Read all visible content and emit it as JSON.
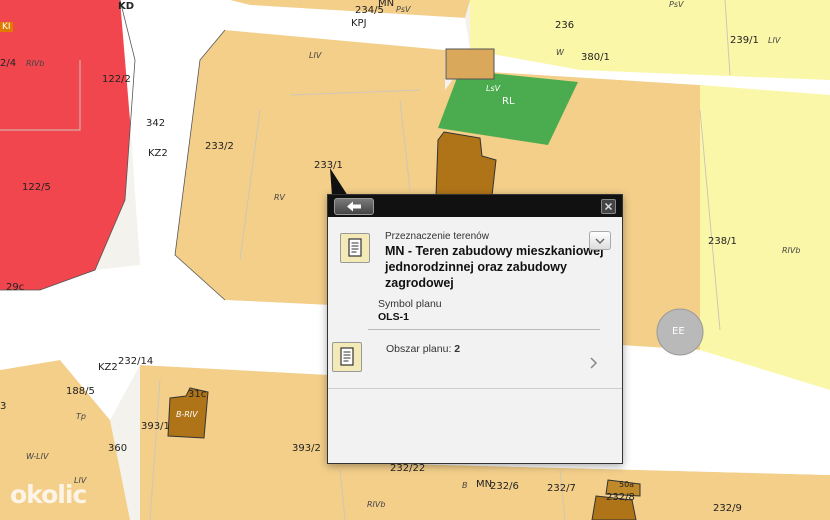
{
  "map": {
    "parcels": [
      {
        "id": "p1",
        "text": "KD"
      },
      {
        "id": "p2",
        "text": "2/4"
      },
      {
        "id": "p3",
        "text": "RIVb"
      },
      {
        "id": "p4",
        "text": "122/2"
      },
      {
        "id": "p5",
        "text": "342"
      },
      {
        "id": "p6",
        "text": "KZ2"
      },
      {
        "id": "p7",
        "text": "122/5"
      },
      {
        "id": "p8",
        "text": "233/2"
      },
      {
        "id": "p9",
        "text": "233/1"
      },
      {
        "id": "p10",
        "text": "RV"
      },
      {
        "id": "p11",
        "text": "LIV"
      },
      {
        "id": "p12",
        "text": "KPJ"
      },
      {
        "id": "p13",
        "text": "234/5"
      },
      {
        "id": "p14",
        "text": "MN"
      },
      {
        "id": "p15",
        "text": "PsV"
      },
      {
        "id": "p16",
        "text": "236"
      },
      {
        "id": "p17",
        "text": "PsV"
      },
      {
        "id": "p18",
        "text": "239/1"
      },
      {
        "id": "p19",
        "text": "LIV"
      },
      {
        "id": "p20",
        "text": "W"
      },
      {
        "id": "p21",
        "text": "380/1"
      },
      {
        "id": "p22",
        "text": "LsV"
      },
      {
        "id": "p23",
        "text": "RL"
      },
      {
        "id": "p24",
        "text": "238/1"
      },
      {
        "id": "p25",
        "text": "RIVb"
      },
      {
        "id": "p26",
        "text": "EE"
      },
      {
        "id": "p27",
        "text": "29c"
      },
      {
        "id": "p28",
        "text": "KZ2"
      },
      {
        "id": "p29",
        "text": "232/14"
      },
      {
        "id": "p30",
        "text": "188/5"
      },
      {
        "id": "p31",
        "text": "Tp"
      },
      {
        "id": "p32",
        "text": "360"
      },
      {
        "id": "p33",
        "text": "W-LIV"
      },
      {
        "id": "p34",
        "text": "LIV"
      },
      {
        "id": "p35",
        "text": "3"
      },
      {
        "id": "p36",
        "text": "31c"
      },
      {
        "id": "p37",
        "text": "B-RIV"
      },
      {
        "id": "p38",
        "text": "393/1"
      },
      {
        "id": "p39",
        "text": "393/2"
      },
      {
        "id": "p40",
        "text": "232/22"
      },
      {
        "id": "p41",
        "text": "B"
      },
      {
        "id": "p42",
        "text": "MN"
      },
      {
        "id": "p43",
        "text": "232/6"
      },
      {
        "id": "p44",
        "text": "232/7"
      },
      {
        "id": "p45",
        "text": "50a"
      },
      {
        "id": "p46",
        "text": "232/8"
      },
      {
        "id": "p47",
        "text": "232/9"
      },
      {
        "id": "p48",
        "text": "RIVb"
      },
      {
        "id": "p49",
        "text": "KI"
      }
    ],
    "watermark": "okolic"
  },
  "popup": {
    "section_label": "Przeznaczenie terenów",
    "title": "MN - Teren zabudowy mieszkaniowej jednorodzinnej oraz zabudowy zagrodowej",
    "symbol_label": "Symbol planu",
    "symbol_value": "OLS-1",
    "area_label": "Obszar planu:",
    "area_value": "2"
  }
}
